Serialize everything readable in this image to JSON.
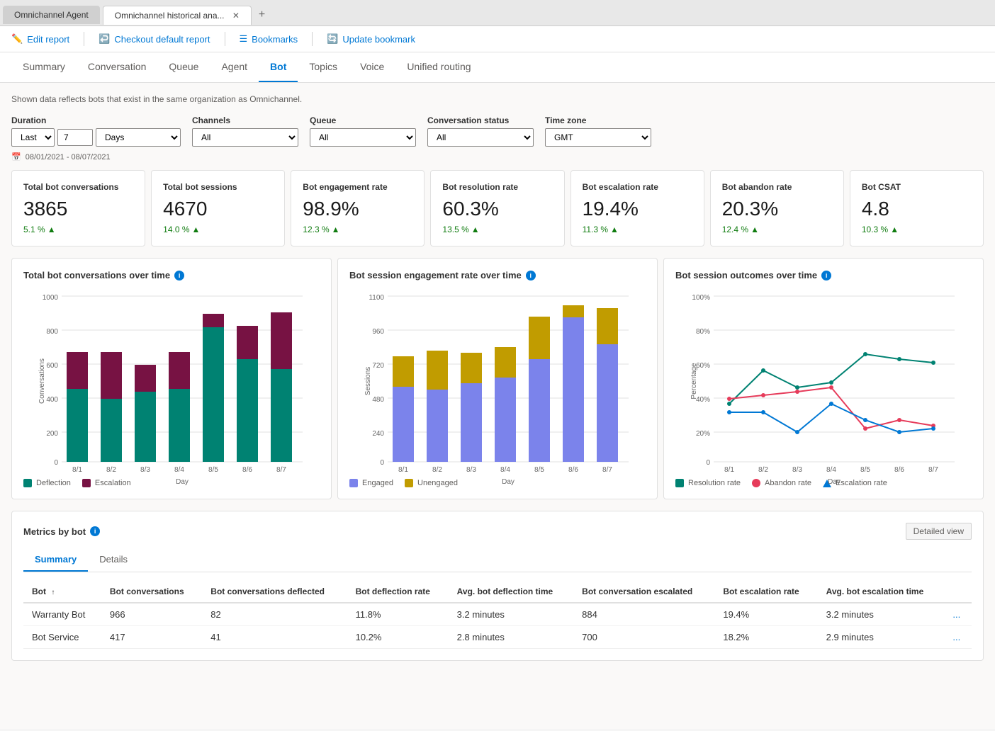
{
  "browser": {
    "tabs": [
      {
        "label": "Omnichannel Agent",
        "active": false,
        "closable": false
      },
      {
        "label": "Omnichannel historical ana...",
        "active": true,
        "closable": true
      }
    ],
    "add_tab": "+"
  },
  "toolbar": {
    "edit_report": "Edit report",
    "checkout_default": "Checkout default report",
    "bookmarks": "Bookmarks",
    "update_bookmark": "Update bookmark"
  },
  "nav": {
    "tabs": [
      "Summary",
      "Conversation",
      "Queue",
      "Agent",
      "Bot",
      "Topics",
      "Voice",
      "Unified routing"
    ],
    "active": "Bot"
  },
  "info_message": "Shown data reflects bots that exist in the same organization as Omnichannel.",
  "filters": {
    "duration_label": "Duration",
    "duration_preset": "Last",
    "duration_value": "7",
    "duration_unit": "Days",
    "channels_label": "Channels",
    "channels_value": "All",
    "queue_label": "Queue",
    "queue_value": "All",
    "conv_status_label": "Conversation status",
    "conv_status_value": "All",
    "timezone_label": "Time zone",
    "timezone_value": "GMT"
  },
  "date_range": "08/01/2021 - 08/07/2021",
  "kpis": [
    {
      "title": "Total bot conversations",
      "value": "3865",
      "change": "5.1 %",
      "positive": true
    },
    {
      "title": "Total bot sessions",
      "value": "4670",
      "change": "14.0 %",
      "positive": true
    },
    {
      "title": "Bot engagement rate",
      "value": "98.9%",
      "change": "12.3 %",
      "positive": true
    },
    {
      "title": "Bot resolution rate",
      "value": "60.3%",
      "change": "13.5 %",
      "positive": true
    },
    {
      "title": "Bot escalation rate",
      "value": "19.4%",
      "change": "11.3 %",
      "positive": true
    },
    {
      "title": "Bot abandon rate",
      "value": "20.3%",
      "change": "12.4 %",
      "positive": true
    },
    {
      "title": "Bot CSAT",
      "value": "4.8",
      "change": "10.3 %",
      "positive": true
    }
  ],
  "charts": {
    "conversations_over_time": {
      "title": "Total bot conversations over time",
      "y_axis_label": "Conversations",
      "x_axis_label": "Day",
      "y_ticks": [
        "0",
        "200",
        "400",
        "600",
        "800",
        "1000"
      ],
      "x_labels": [
        "8/1",
        "8/2",
        "8/3",
        "8/4",
        "8/5",
        "8/6",
        "8/7"
      ],
      "bars": [
        {
          "deflection": 440,
          "escalation": 220
        },
        {
          "deflection": 380,
          "escalation": 280
        },
        {
          "deflection": 420,
          "escalation": 160
        },
        {
          "deflection": 440,
          "escalation": 220
        },
        {
          "deflection": 810,
          "escalation": 80
        },
        {
          "deflection": 620,
          "escalation": 200
        },
        {
          "deflection": 560,
          "escalation": 340
        }
      ],
      "legend": [
        {
          "label": "Deflection",
          "color": "#008272"
        },
        {
          "label": "Escalation",
          "color": "#771243"
        }
      ]
    },
    "session_engagement": {
      "title": "Bot session engagement rate over time",
      "y_axis_label": "Sessions",
      "x_axis_label": "Day",
      "y_ticks": [
        "0",
        "240",
        "480",
        "720",
        "960",
        "1100"
      ],
      "x_labels": [
        "8/1",
        "8/2",
        "8/3",
        "8/4",
        "8/5",
        "8/6",
        "8/7"
      ],
      "bars": [
        {
          "engaged": 500,
          "unengaged": 200
        },
        {
          "engaged": 480,
          "unengaged": 260
        },
        {
          "engaged": 520,
          "unengaged": 200
        },
        {
          "engaged": 560,
          "unengaged": 200
        },
        {
          "engaged": 680,
          "unengaged": 280
        },
        {
          "engaged": 960,
          "unengaged": 80
        },
        {
          "engaged": 780,
          "unengaged": 240
        }
      ],
      "legend": [
        {
          "label": "Engaged",
          "color": "#7B83EB"
        },
        {
          "label": "Unengaged",
          "color": "#C19C00"
        }
      ]
    },
    "outcomes_over_time": {
      "title": "Bot session outcomes over time",
      "y_axis_label": "Percentage",
      "x_axis_label": "Day",
      "y_ticks": [
        "0",
        "20%",
        "40%",
        "60%",
        "80%",
        "100%"
      ],
      "x_labels": [
        "8/1",
        "8/2",
        "8/3",
        "8/4",
        "8/5",
        "8/6",
        "8/7"
      ],
      "lines": [
        {
          "label": "Resolution rate",
          "color": "#008272",
          "points": [
            35,
            55,
            45,
            48,
            65,
            62,
            60
          ]
        },
        {
          "label": "Abandon rate",
          "color": "#E63B5A",
          "points": [
            38,
            40,
            42,
            45,
            20,
            25,
            22
          ]
        },
        {
          "label": "Escalation rate",
          "color": "#0078D4",
          "points": [
            30,
            30,
            18,
            35,
            25,
            18,
            20
          ]
        }
      ],
      "legend": [
        {
          "label": "Resolution rate",
          "color": "#008272",
          "shape": "square"
        },
        {
          "label": "Abandon rate",
          "color": "#E63B5A",
          "shape": "circle"
        },
        {
          "label": "Escalation rate",
          "color": "#0078D4",
          "shape": "triangle"
        }
      ]
    }
  },
  "metrics": {
    "title": "Metrics by bot",
    "detailed_view_label": "Detailed view",
    "tabs": [
      "Summary",
      "Details"
    ],
    "active_tab": "Summary",
    "columns": [
      "Bot",
      "Bot conversations",
      "Bot conversations deflected",
      "Bot deflection rate",
      "Avg. bot deflection time",
      "Bot conversation escalated",
      "Bot escalation rate",
      "Avg. bot escalation time"
    ],
    "rows": [
      {
        "bot": "Warranty Bot",
        "conversations": "966",
        "deflected": "82",
        "deflection_rate": "11.8%",
        "avg_deflection": "3.2 minutes",
        "escalated": "884",
        "escalation_rate": "19.4%",
        "avg_escalation": "3.2 minutes"
      },
      {
        "bot": "Bot Service",
        "conversations": "417",
        "deflected": "41",
        "deflection_rate": "10.2%",
        "avg_deflection": "2.8 minutes",
        "escalated": "700",
        "escalation_rate": "18.2%",
        "avg_escalation": "2.9 minutes"
      }
    ]
  }
}
